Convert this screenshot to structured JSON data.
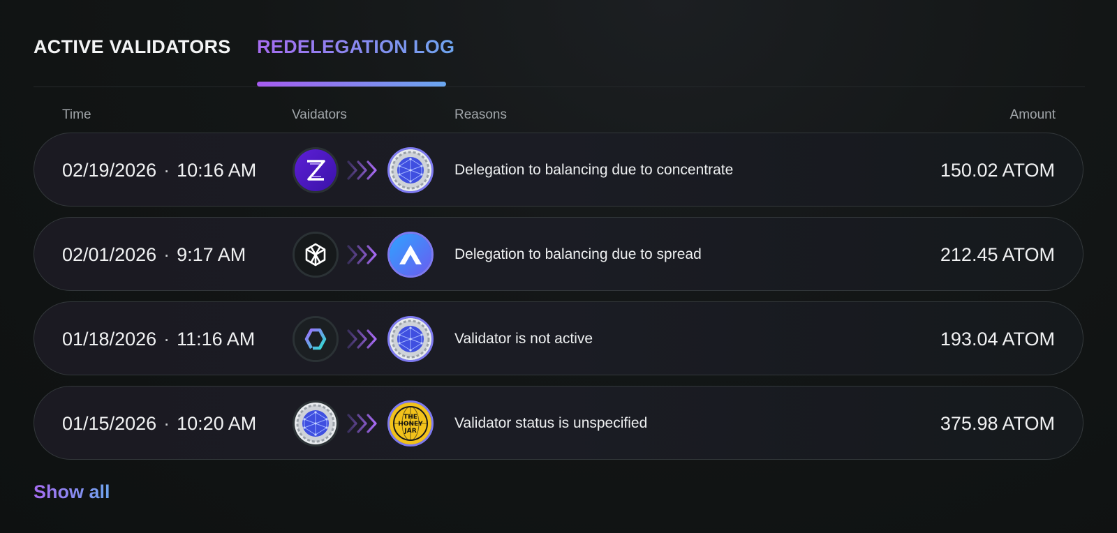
{
  "tabs": {
    "active_validators": "ACTIVE VALIDATORS",
    "redelegation_log": "REDELEGATION LOG",
    "selected": "redelegation_log"
  },
  "table": {
    "headers": {
      "time": "Time",
      "validators": "Vaidators",
      "reasons": "Reasons",
      "amount": "Amount"
    },
    "rows": [
      {
        "date": "02/19/2026",
        "time": "10:16 AM",
        "from_icon": "z-logo-icon",
        "to_icon": "globe-network-icon",
        "reason": "Delegation to balancing due to concentrate",
        "amount": "150.02 ATOM"
      },
      {
        "date": "02/01/2026",
        "time": "9:17 AM",
        "from_icon": "hexagon-cube-icon",
        "to_icon": "a-chevron-logo-icon",
        "reason": "Delegation to balancing due to spread",
        "amount": "212.45 ATOM"
      },
      {
        "date": "01/18/2026",
        "time": "11:16 AM",
        "from_icon": "hex-link-icon",
        "to_icon": "globe-network-icon",
        "reason": "Validator is not active",
        "amount": "193.04 ATOM"
      },
      {
        "date": "01/15/2026",
        "time": "10:20 AM",
        "from_icon": "globe-network-icon",
        "to_icon": "the-honey-jar-icon",
        "reason": "Validator status is unspecified",
        "amount": "375.98 ATOM"
      }
    ]
  },
  "separator": "·",
  "footer": {
    "show_all": "Show all"
  },
  "colors": {
    "accent_start": "#a66cf0",
    "accent_end": "#6ea5ef",
    "background": "#131616",
    "row_border": "#33383b"
  }
}
